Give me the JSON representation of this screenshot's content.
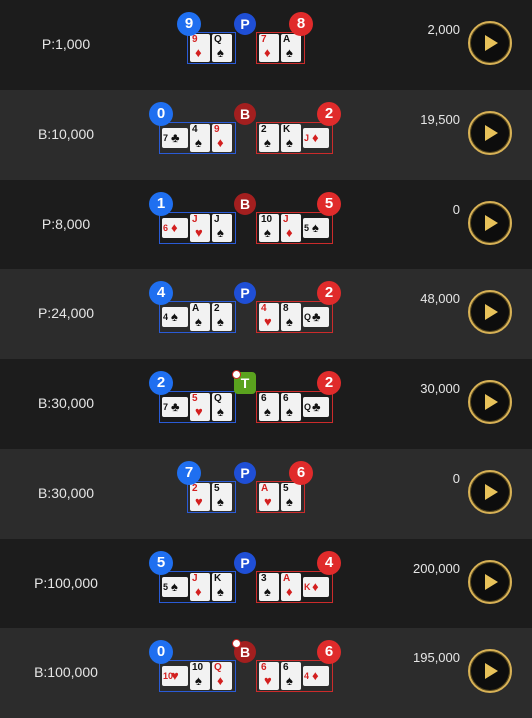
{
  "rows": [
    {
      "bet": "P:1,000",
      "payout": "2,000",
      "result": "P",
      "player": {
        "score": "9",
        "cards": [
          {
            "r": "9",
            "s": "♦",
            "c": "red"
          },
          {
            "r": "Q",
            "s": "♠",
            "c": "blk"
          }
        ]
      },
      "banker": {
        "score": "8",
        "cards": [
          {
            "r": "7",
            "s": "♦",
            "c": "red"
          },
          {
            "r": "A",
            "s": "♠",
            "c": "blk"
          }
        ]
      },
      "pair": false
    },
    {
      "bet": "B:10,000",
      "payout": "19,500",
      "result": "B",
      "player": {
        "score": "0",
        "cards": [
          {
            "r": "7",
            "s": "♣",
            "c": "blk",
            "side": true
          },
          {
            "r": "4",
            "s": "♠",
            "c": "blk"
          },
          {
            "r": "9",
            "s": "♦",
            "c": "red"
          }
        ]
      },
      "banker": {
        "score": "2",
        "cards": [
          {
            "r": "2",
            "s": "♠",
            "c": "blk"
          },
          {
            "r": "K",
            "s": "♠",
            "c": "blk"
          },
          {
            "r": "J",
            "s": "♦",
            "c": "red",
            "side": true
          }
        ]
      },
      "pair": false
    },
    {
      "bet": "P:8,000",
      "payout": "0",
      "result": "B",
      "player": {
        "score": "1",
        "cards": [
          {
            "r": "6",
            "s": "♦",
            "c": "red",
            "side": true
          },
          {
            "r": "J",
            "s": "♥",
            "c": "red"
          },
          {
            "r": "J",
            "s": "♠",
            "c": "blk"
          }
        ]
      },
      "banker": {
        "score": "5",
        "cards": [
          {
            "r": "10",
            "s": "♠",
            "c": "blk"
          },
          {
            "r": "J",
            "s": "♦",
            "c": "red"
          },
          {
            "r": "5",
            "s": "♠",
            "c": "blk",
            "side": true
          }
        ]
      },
      "pair": false
    },
    {
      "bet": "P:24,000",
      "payout": "48,000",
      "result": "P",
      "player": {
        "score": "4",
        "cards": [
          {
            "r": "4",
            "s": "♠",
            "c": "blk",
            "side": true
          },
          {
            "r": "A",
            "s": "♠",
            "c": "blk"
          },
          {
            "r": "2",
            "s": "♠",
            "c": "blk"
          }
        ]
      },
      "banker": {
        "score": "2",
        "cards": [
          {
            "r": "4",
            "s": "♥",
            "c": "red"
          },
          {
            "r": "8",
            "s": "♠",
            "c": "blk"
          },
          {
            "r": "Q",
            "s": "♣",
            "c": "blk",
            "side": true
          }
        ]
      },
      "pair": false
    },
    {
      "bet": "B:30,000",
      "payout": "30,000",
      "result": "T",
      "player": {
        "score": "2",
        "cards": [
          {
            "r": "7",
            "s": "♣",
            "c": "blk",
            "side": true
          },
          {
            "r": "5",
            "s": "♥",
            "c": "red"
          },
          {
            "r": "Q",
            "s": "♠",
            "c": "blk"
          }
        ]
      },
      "banker": {
        "score": "2",
        "cards": [
          {
            "r": "6",
            "s": "♠",
            "c": "blk"
          },
          {
            "r": "6",
            "s": "♠",
            "c": "blk"
          },
          {
            "r": "Q",
            "s": "♣",
            "c": "blk",
            "side": true
          }
        ]
      },
      "pair": true
    },
    {
      "bet": "B:30,000",
      "payout": "0",
      "result": "P",
      "player": {
        "score": "7",
        "cards": [
          {
            "r": "2",
            "s": "♥",
            "c": "red"
          },
          {
            "r": "5",
            "s": "♠",
            "c": "blk"
          }
        ]
      },
      "banker": {
        "score": "6",
        "cards": [
          {
            "r": "A",
            "s": "♥",
            "c": "red"
          },
          {
            "r": "5",
            "s": "♠",
            "c": "blk"
          }
        ]
      },
      "pair": false
    },
    {
      "bet": "P:100,000",
      "payout": "200,000",
      "result": "P",
      "player": {
        "score": "5",
        "cards": [
          {
            "r": "5",
            "s": "♠",
            "c": "blk",
            "side": true
          },
          {
            "r": "J",
            "s": "♦",
            "c": "red"
          },
          {
            "r": "K",
            "s": "♠",
            "c": "blk"
          }
        ]
      },
      "banker": {
        "score": "4",
        "cards": [
          {
            "r": "3",
            "s": "♠",
            "c": "blk"
          },
          {
            "r": "A",
            "s": "♦",
            "c": "red"
          },
          {
            "r": "K",
            "s": "♦",
            "c": "red",
            "side": true
          }
        ]
      },
      "pair": false
    },
    {
      "bet": "B:100,000",
      "payout": "195,000",
      "result": "B",
      "player": {
        "score": "0",
        "cards": [
          {
            "r": "10",
            "s": "♥",
            "c": "red",
            "side": true
          },
          {
            "r": "10",
            "s": "♠",
            "c": "blk"
          },
          {
            "r": "Q",
            "s": "♦",
            "c": "red"
          }
        ]
      },
      "banker": {
        "score": "6",
        "cards": [
          {
            "r": "6",
            "s": "♥",
            "c": "red"
          },
          {
            "r": "6",
            "s": "♠",
            "c": "blk"
          },
          {
            "r": "4",
            "s": "♦",
            "c": "red",
            "side": true
          }
        ]
      },
      "pair": true
    }
  ],
  "colors": {
    "player": "#1f6ff0",
    "banker": "#e02b2b",
    "tie": "#5aa21e",
    "play_ring": "#d8b256"
  },
  "icons": {
    "play": "play-icon"
  }
}
